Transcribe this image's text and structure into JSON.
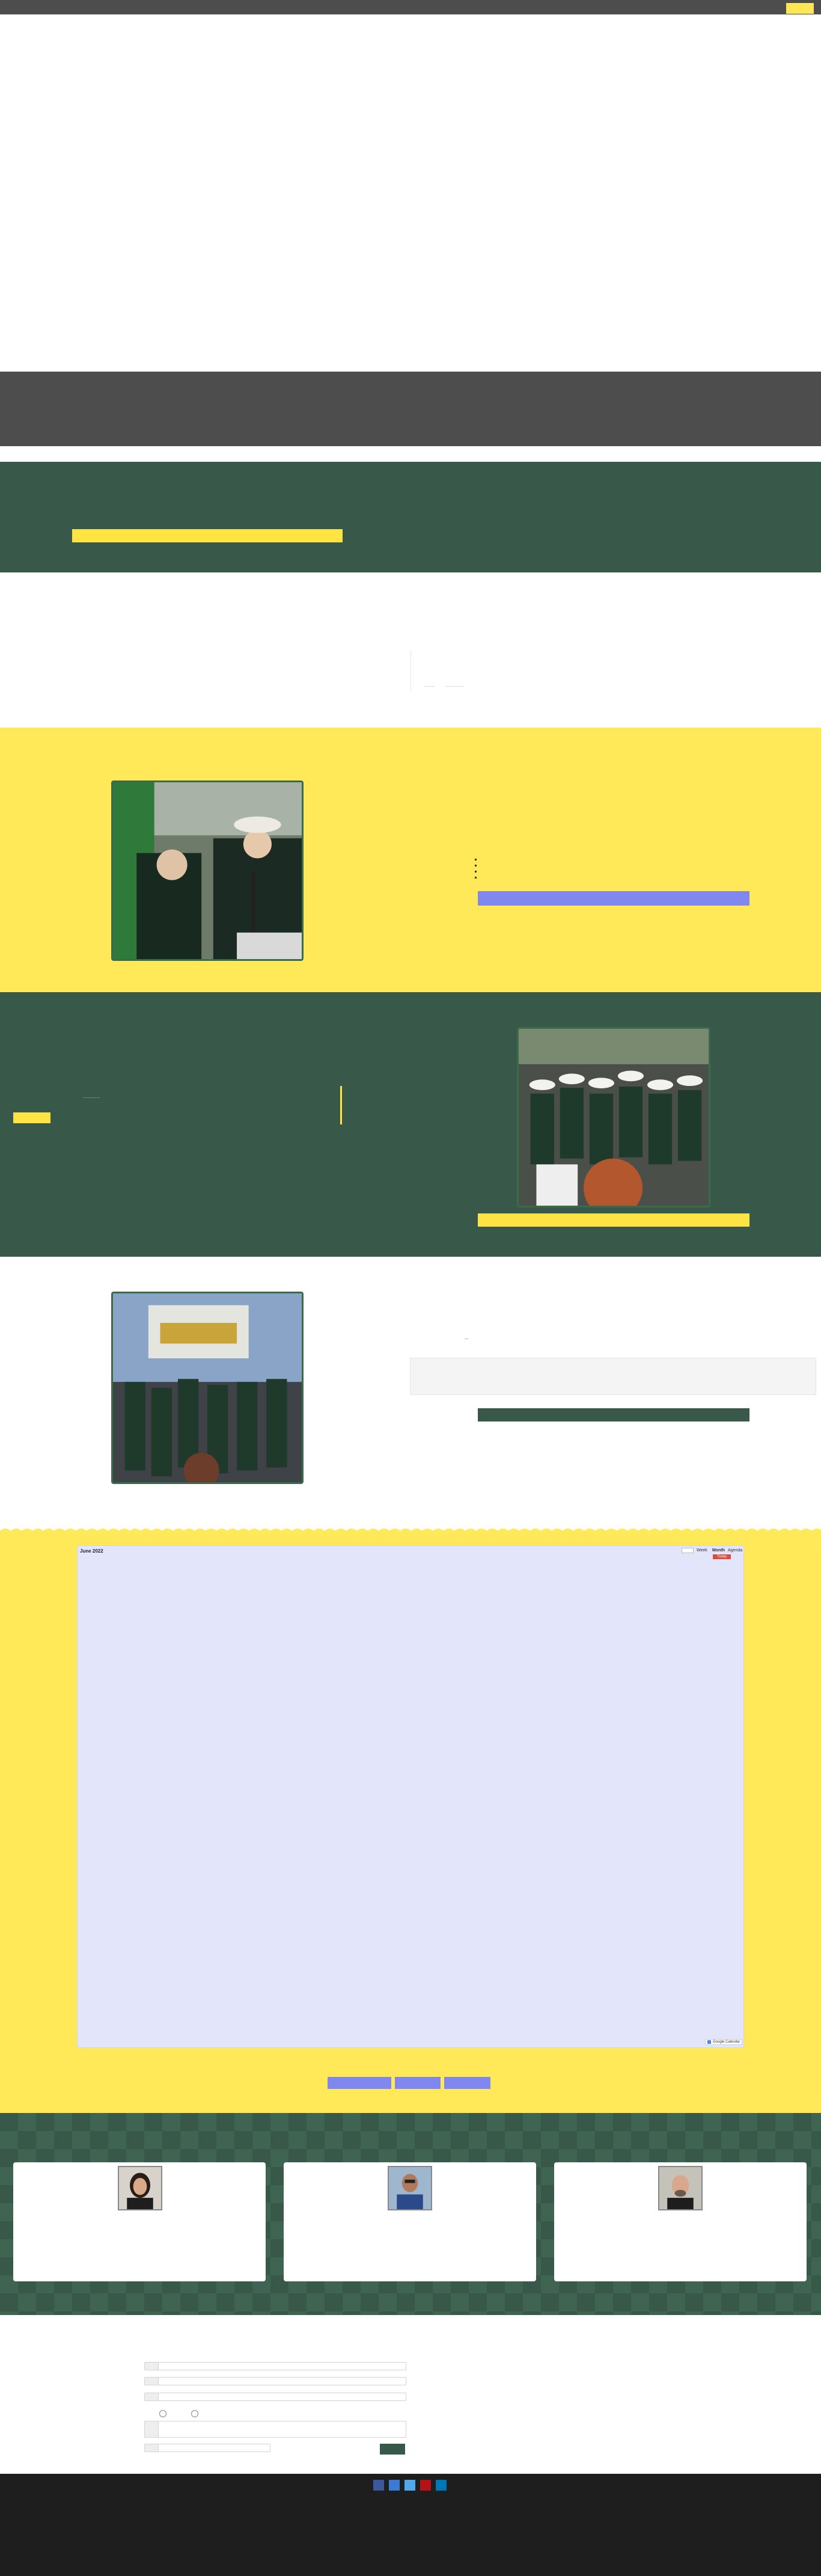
{
  "calendar": {
    "month_label": "June 2022",
    "view_buttons": [
      "Week",
      "Month",
      "Agenda"
    ],
    "today_label": "Today",
    "footer_label": "Google Calendar"
  },
  "colors": {
    "green": "#385949",
    "yellow": "#ffe959",
    "dark_gray": "#4d4d4d",
    "purple": "#8088ef",
    "calendar_bg": "#e3e6fb",
    "footer": "#1e1e1e"
  },
  "icons": [
    "facebook-icon",
    "twitter-icon",
    "instagram-icon",
    "youtube-icon",
    "linkedin-icon"
  ]
}
